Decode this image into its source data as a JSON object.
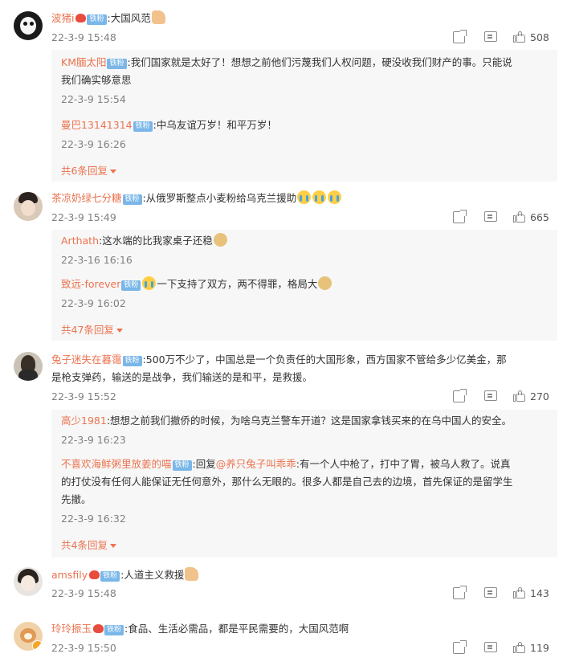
{
  "comments": [
    {
      "user": "波猪i",
      "badge": "铁粉",
      "text": ":大国风范",
      "emoji_after": "thumbs-up-emoji",
      "time": "22-3-9 15:48",
      "likes": "508",
      "replies": [
        {
          "user": "KM腼太阳",
          "badge": "铁粉",
          "text_line1": ":我们国家就是太好了！想想之前他们污蔑我们人权问题，硬没收我们财产的事。只能说",
          "text_line2": "我们确实够意思",
          "time": "22-3-9 15:54"
        },
        {
          "user": "曼巴13141314",
          "badge": "铁粉",
          "text_line1": ":中乌友谊万岁！和平万岁！",
          "time": "22-3-9 16:26"
        }
      ],
      "more": "共6条回复"
    },
    {
      "user": "茶凉奶绿七分糖",
      "badge": "铁粉",
      "text": ":从俄罗斯整点小麦粉给乌克兰援助",
      "time": "22-3-9 15:49",
      "likes": "665",
      "replies": [
        {
          "user": "Arthath",
          "text_line1": ":这水端的比我家桌子还稳",
          "time": "22-3-16 16:16"
        },
        {
          "user": "致远-forever",
          "badge": "铁粉",
          "text_line1": "一下支持了双方，两不得罪，格局大",
          "time": "22-3-9 16:02"
        }
      ],
      "more": "共47条回复"
    },
    {
      "user": "兔子迷失在暮霭",
      "badge": "铁粉",
      "text": ":500万不少了，中国总是一个负责任的大国形象，西方国家不管给多少亿美金，那",
      "text_line2": "是枪支弹药，输送的是战争，我们输送的是和平，是救援。",
      "time": "22-3-9 15:52",
      "likes": "270",
      "replies": [
        {
          "user": "高少1981",
          "text_line1": ":想想之前我们撤侨的时候，为啥乌克兰警车开道？这是国家拿钱买来的在乌中国人的安全。",
          "time": "22-3-9 16:23"
        },
        {
          "user": "不喜欢海鲜粥里放姜的喵",
          "badge": "铁粉",
          "reply_prefix": ":回复",
          "mention": "@养只兔子叫乖乖",
          "text_line1": ":有一个人中枪了，打中了胃，被乌人救了。说真",
          "text_line2": "的打仗没有任何人能保证无任何意外，那什么无眼的。很多人都是自己去的边境，首先保证的是留学生",
          "text_line3": "先撤。",
          "time": "22-3-9 16:32"
        }
      ],
      "more": "共4条回复"
    },
    {
      "user": "amsfily",
      "badge": "铁粉",
      "text": ":人道主义救援",
      "time": "22-3-9 15:48",
      "likes": "143"
    },
    {
      "user": "玲玲振玉",
      "badge": "铁粉",
      "text": ":食品、生活必需品，都是平民需要的，大国风范啊",
      "time": "22-3-9 15:50",
      "likes": "119"
    }
  ],
  "icons": {
    "share": "share-icon",
    "comment": "comment-icon",
    "like": "like-icon"
  },
  "colors": {
    "username": "#eb7350",
    "badge": "#7ab7e8",
    "time": "#808080",
    "reply_bg": "#f7f7f7"
  }
}
